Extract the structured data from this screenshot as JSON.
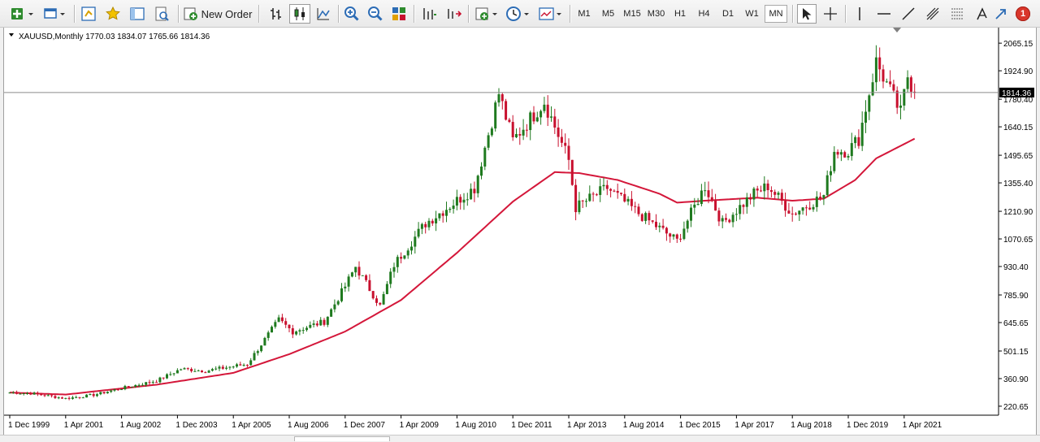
{
  "toolbar": {
    "new_order_label": "New Order",
    "timeframes": [
      "M1",
      "M5",
      "M15",
      "M30",
      "H1",
      "H4",
      "D1",
      "W1",
      "MN"
    ],
    "active_timeframe": "MN",
    "notification_count": "1"
  },
  "chart_header": {
    "symbol": "XAUUSD",
    "period": "Monthly",
    "ohlc": "1770.03 1834.07 1765.66 1814.36"
  },
  "chart_data": {
    "type": "candlestick",
    "y_ticks": [
      "2065.15",
      "1924.90",
      "1780.40",
      "1640.15",
      "1495.65",
      "1355.40",
      "1210.90",
      "1070.65",
      "930.40",
      "785.90",
      "645.65",
      "501.15",
      "360.90",
      "220.65"
    ],
    "y_tick_values": [
      2065.15,
      1924.9,
      1780.4,
      1640.15,
      1495.65,
      1355.4,
      1210.9,
      1070.65,
      930.4,
      785.9,
      645.65,
      501.15,
      360.9,
      220.65
    ],
    "x_ticks": [
      "1 Dec 1999",
      "1 Apr 2001",
      "1 Aug 2002",
      "1 Dec 2003",
      "1 Apr 2005",
      "1 Aug 2006",
      "1 Dec 2007",
      "1 Apr 2009",
      "1 Aug 2010",
      "1 Dec 2011",
      "1 Apr 2013",
      "1 Aug 2014",
      "1 Dec 2015",
      "1 Apr 2017",
      "1 Aug 2018",
      "1 Dec 2019",
      "1 Apr 2021"
    ],
    "ylim": [
      220.65,
      2065.15
    ],
    "x_range": [
      "1999-12",
      "2021-07"
    ],
    "current_price": "1814.36",
    "current_price_value": 1814.36,
    "grid": false,
    "bull_color": "#1f7a1f",
    "bear_color": "#c8102e",
    "ma_color": "#d4173a",
    "close_anchors": [
      [
        "1999-12",
        290
      ],
      [
        "2000-06",
        286
      ],
      [
        "2001-04",
        260
      ],
      [
        "2001-12",
        278
      ],
      [
        "2002-08",
        312
      ],
      [
        "2003-06",
        350
      ],
      [
        "2004-01",
        410
      ],
      [
        "2004-08",
        400
      ],
      [
        "2005-08",
        435
      ],
      [
        "2006-05",
        660
      ],
      [
        "2006-09",
        600
      ],
      [
        "2007-06",
        650
      ],
      [
        "2007-12",
        830
      ],
      [
        "2008-03",
        930
      ],
      [
        "2008-10",
        730
      ],
      [
        "2009-02",
        940
      ],
      [
        "2009-11",
        1150
      ],
      [
        "2010-06",
        1240
      ],
      [
        "2011-01",
        1330
      ],
      [
        "2011-08",
        1810
      ],
      [
        "2011-12",
        1570
      ],
      [
        "2012-09",
        1770
      ],
      [
        "2013-04",
        1470
      ],
      [
        "2013-06",
        1230
      ],
      [
        "2014-03",
        1330
      ],
      [
        "2014-12",
        1200
      ],
      [
        "2015-11",
        1060
      ],
      [
        "2016-07",
        1340
      ],
      [
        "2016-12",
        1150
      ],
      [
        "2017-09",
        1300
      ],
      [
        "2018-01",
        1340
      ],
      [
        "2018-08",
        1200
      ],
      [
        "2019-05",
        1290
      ],
      [
        "2019-08",
        1520
      ],
      [
        "2019-12",
        1520
      ],
      [
        "2020-03",
        1580
      ],
      [
        "2020-08",
        1970
      ],
      [
        "2021-03",
        1710
      ],
      [
        "2021-05",
        1900
      ],
      [
        "2021-07",
        1814
      ]
    ],
    "ma_anchors": [
      [
        "1999-12",
        290
      ],
      [
        "2001-04",
        280
      ],
      [
        "2003-06",
        330
      ],
      [
        "2005-04",
        390
      ],
      [
        "2006-08",
        485
      ],
      [
        "2007-12",
        600
      ],
      [
        "2009-04",
        760
      ],
      [
        "2010-08",
        1000
      ],
      [
        "2011-12",
        1260
      ],
      [
        "2012-12",
        1410
      ],
      [
        "2013-07",
        1405
      ],
      [
        "2014-06",
        1370
      ],
      [
        "2015-06",
        1300
      ],
      [
        "2015-11",
        1255
      ],
      [
        "2016-07",
        1265
      ],
      [
        "2017-10",
        1280
      ],
      [
        "2018-08",
        1265
      ],
      [
        "2019-05",
        1275
      ],
      [
        "2020-02",
        1370
      ],
      [
        "2020-08",
        1480
      ],
      [
        "2021-07",
        1580
      ]
    ]
  }
}
